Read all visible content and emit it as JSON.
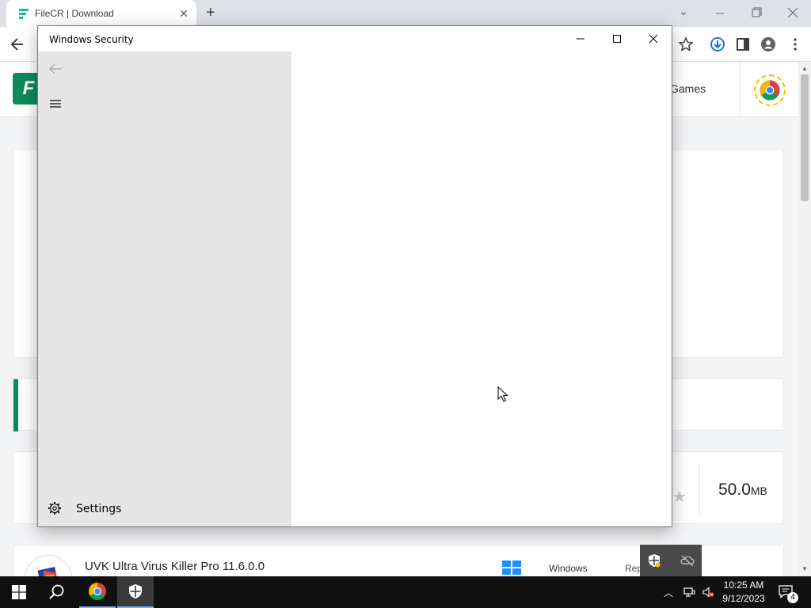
{
  "browser": {
    "tab_title": "FileCR | Download",
    "new_tab_symbol": "+",
    "tab_close_symbol": "✕"
  },
  "website": {
    "logo_letter": "F",
    "nav_item": "Games",
    "file_size_value": "50.0",
    "file_size_unit": "MB",
    "product_name": "UVK Ultra Virus Killer Pro 11.6.0.0",
    "product_os": "Windows",
    "product_reputation": "Reputation"
  },
  "security_window": {
    "title": "Windows Security",
    "settings_label": "Settings"
  },
  "taskbar": {
    "time": "10:25 AM",
    "date": "9/12/2023",
    "notification_count": "4"
  },
  "colors": {
    "accent": "#0e8a5c",
    "taskbar": "#101010",
    "sidebar": "#e6e6e6"
  }
}
